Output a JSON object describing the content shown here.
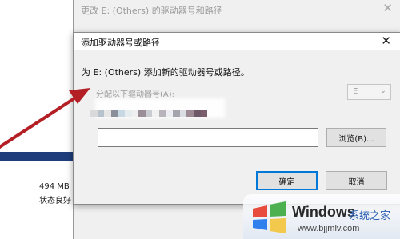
{
  "background": {
    "partition_size": "494 MB",
    "partition_status": "状态良好"
  },
  "outer_dialog": {
    "title": "更改 E: (Others) 的驱动器号和路径",
    "close_glyph": "✕"
  },
  "dialog": {
    "title": "添加驱动器号或路径",
    "close_glyph": "✕",
    "instruction": "为 E: (Others) 添加新的驱动器号或路径。",
    "assign_letter_label": "分配以下驱动器号(A):",
    "drive_letter": "E",
    "drive_chevron": "⌄",
    "path_value": "",
    "browse_button": "浏览(B)...",
    "ok_button": "确定",
    "cancel_button": "取消"
  },
  "watermark": {
    "brand": "Windows",
    "tagline": "系统之家",
    "url": "www.bjjmlv.com"
  },
  "colors": {
    "annotation_arrow": "#b31f24",
    "dialog_bg": "#f0f0f0",
    "title_bar_bg": "#ffffff",
    "default_button_border": "#0078d7",
    "background_strip": "#1f3d7a"
  }
}
